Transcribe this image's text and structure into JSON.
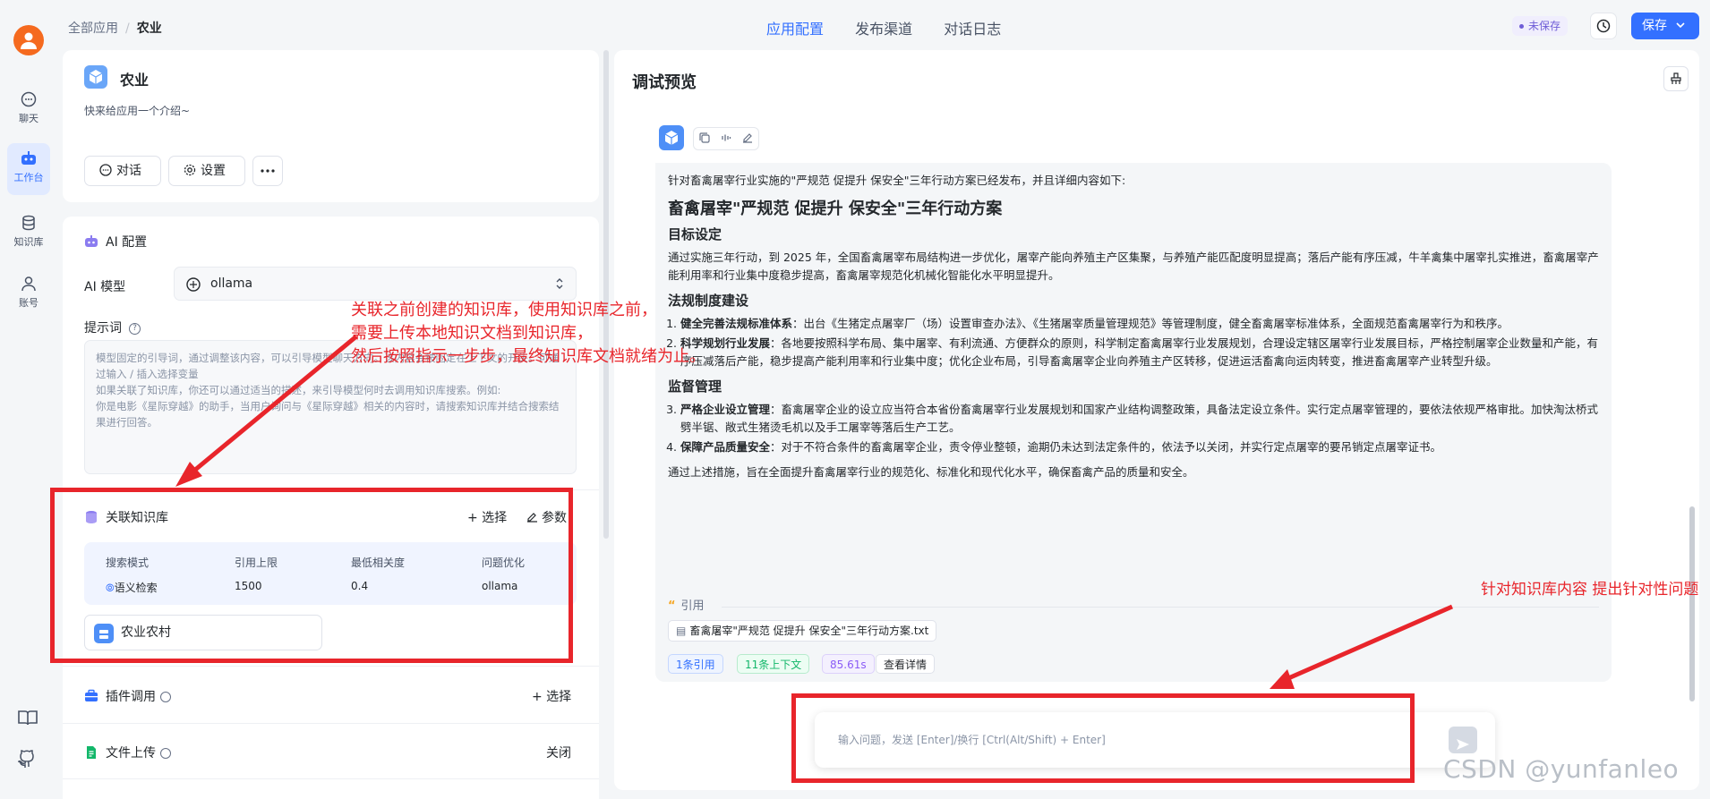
{
  "rail": {
    "items": [
      {
        "label": "聊天",
        "icon": "chat-icon"
      },
      {
        "label": "工作台",
        "icon": "robot-icon",
        "active": true
      },
      {
        "label": "知识库",
        "icon": "database-icon"
      },
      {
        "label": "账号",
        "icon": "user-icon"
      }
    ],
    "bottom_icons": [
      "book-icon",
      "github-icon"
    ]
  },
  "header": {
    "breadcrumb_root": "全部应用",
    "breadcrumb_current": "农业",
    "tabs": [
      "应用配置",
      "发布渠道",
      "对话日志"
    ],
    "active_tab": "应用配置",
    "unsaved_label": "未保存",
    "save_label": "保存"
  },
  "app": {
    "name": "农业",
    "intro": "快来给应用一个介绍~",
    "buttons": {
      "chat": "对话",
      "settings": "设置"
    }
  },
  "ai_config": {
    "title": "AI 配置",
    "model_label": "AI 模型",
    "model_value": "ollama",
    "prompt_label": "提示词",
    "prompt_help": "?",
    "prompt_placeholder": "模型固定的引导词，通过调整该内容，可以引导模型聊天方向。该内容会被固定在上下文的开头。可通过输入 / 插入选择变量\n如果关联了知识库，你还可以通过适当的描述，来引导模型何时去调用知识库搜索。例如:\n你是电影《星际穿越》的助手，当用户询问与《星际穿越》相关的内容时，请搜索知识库并结合搜索结果进行回答。"
  },
  "knowledge": {
    "title": "关联知识库",
    "select_label": "+ 选择",
    "params_label": "参数",
    "columns": [
      "搜索模式",
      "引用上限",
      "最低相关度",
      "问题优化"
    ],
    "values": [
      "语义检索",
      "1500",
      "0.4",
      "ollama"
    ],
    "dataset": "农业农村"
  },
  "plugins": {
    "title": "插件调用",
    "action": "+ 选择"
  },
  "file_upload": {
    "title": "文件上传",
    "action": "关闭"
  },
  "preview": {
    "title": "调试预览",
    "intro": "针对畜禽屠宰行业实施的\"严规范 促提升 保安全\"三年行动方案已经发布，并且详细内容如下:",
    "h1": "畜禽屠宰\"严规范 促提升 保安全\"三年行动方案",
    "sec1_title": "目标设定",
    "sec1_text": "通过实施三年行动，到 2025 年，全国畜禽屠宰布局结构进一步优化，屠宰产能向养殖主产区集聚，与养殖产能匹配度明显提高；落后产能有序压减，牛羊禽集中屠宰扎实推进，畜禽屠宰产能利用率和行业集中度稳步提高，畜禽屠宰规范化机械化智能化水平明显提升。",
    "sec2_title": "法规制度建设",
    "sec2_items": [
      {
        "bold": "健全完善法规标准体系",
        "text": "：出台《生猪定点屠宰厂（场）设置审查办法》、《生猪屠宰质量管理规范》等管理制度，健全畜禽屠宰标准体系，全面规范畜禽屠宰行为和秩序。"
      },
      {
        "bold": "科学规划行业发展",
        "text": "：各地要按照科学布局、集中屠宰、有利流通、方便群众的原则，科学制定畜禽屠宰行业发展规划，合理设定辖区屠宰行业发展目标，严格控制屠宰企业数量和产能，有序压减落后产能，稳步提高产能利用率和行业集中度；优化企业布局，引导畜禽屠宰企业向养殖主产区转移，促进运活畜禽向运肉转变，推进畜禽屠宰产业转型升级。"
      }
    ],
    "sec3_title": "监督管理",
    "sec3_items": [
      {
        "bold": "严格企业设立管理",
        "text": "：畜禽屠宰企业的设立应当符合本省份畜禽屠宰行业发展规划和国家产业结构调整政策，具备法定设立条件。实行定点屠宰管理的，要依法依规严格审批。加快淘汰桥式劈半锯、敞式生猪烫毛机以及手工屠宰等落后生产工艺。"
      },
      {
        "bold": "保障产品质量安全",
        "text": "：对于不符合条件的畜禽屠宰企业，责令停业整顿，逾期仍未达到法定条件的，依法予以关闭，并实行定点屠宰的要吊销定点屠宰证书。"
      }
    ],
    "summary": "通过上述措施，旨在全面提升畜禽屠宰行业的规范化、标准化和现代化水平，确保畜禽产品的质量和安全。",
    "cite_label": "引用",
    "cite_file": "畜禽屠宰\"严规范 促提升 保安全\"三年行动方案.txt",
    "tags": [
      "1条引用",
      "11条上下文",
      "85.61s",
      "查看详情"
    ],
    "input_placeholder": "输入问题，发送 [Enter]/换行 [Ctrl(Alt/Shift) + Enter]"
  },
  "annotations": {
    "left_note": [
      "关联之前创建的知识库，使用知识库之前，",
      "需要上传本地知识文档到知识库，",
      "然后按照指示一步步，最终知识库文档就绪为止。"
    ],
    "right_note": "针对知识库内容 提出针对性问题"
  },
  "watermark": "CSDN @yunfanleo",
  "colors": {
    "accent": "#3370ff",
    "annotation": "#e8252b",
    "unsaved": "#6f5dd7"
  }
}
